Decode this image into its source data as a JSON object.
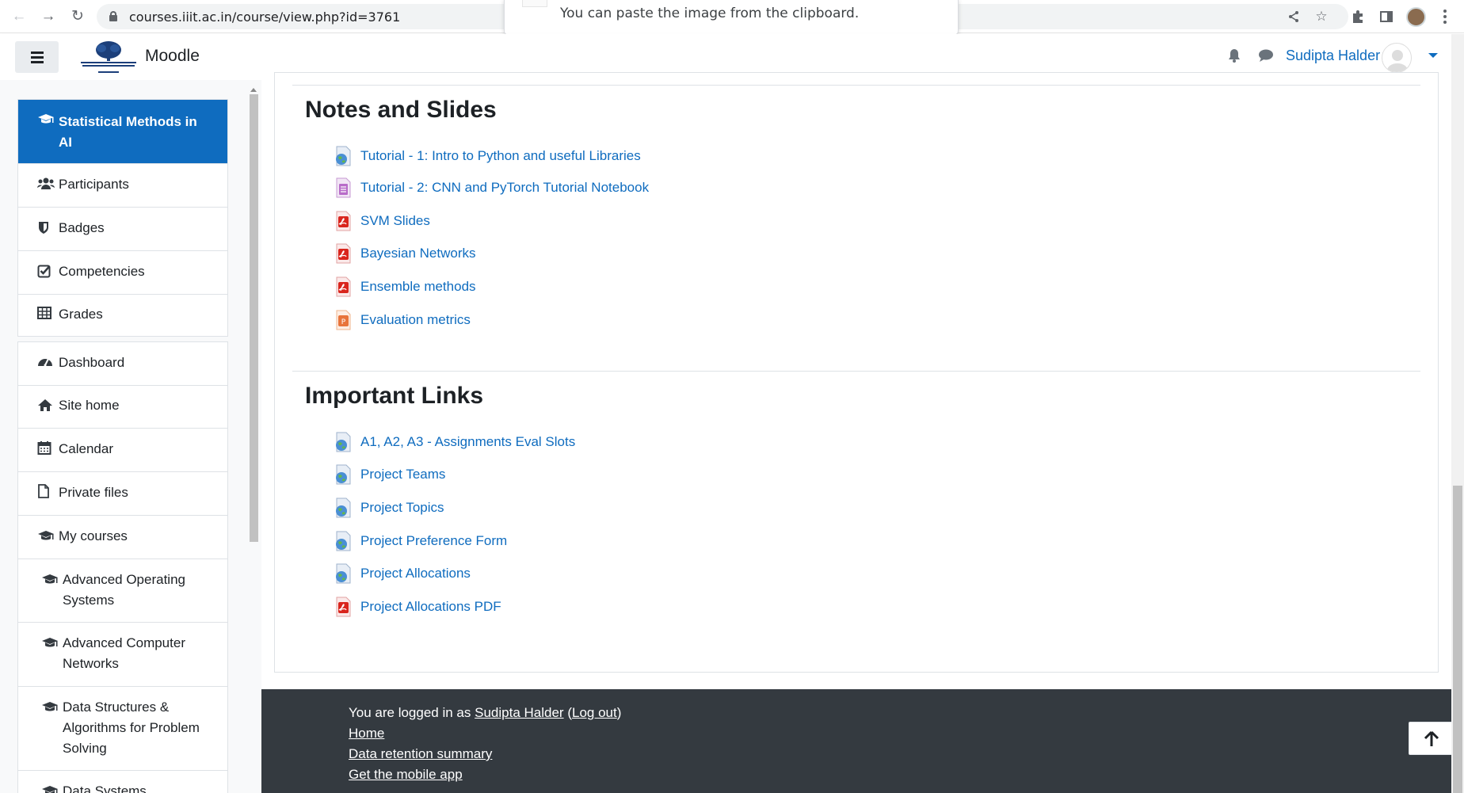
{
  "browser": {
    "url": "courses.iiit.ac.in/course/view.php?id=3761",
    "toast_text": "You can paste the image from the clipboard."
  },
  "navbar": {
    "brand": "Moodle",
    "user_name": "Sudipta Halder"
  },
  "sidebar": {
    "course_items": [
      {
        "label": "Statistical Methods in AI",
        "icon": "graduation-cap-icon",
        "active": true
      },
      {
        "label": "Participants",
        "icon": "users-icon"
      },
      {
        "label": "Badges",
        "icon": "shield-icon"
      },
      {
        "label": "Competencies",
        "icon": "check-square-icon"
      },
      {
        "label": "Grades",
        "icon": "table-icon"
      }
    ],
    "site_items": [
      {
        "label": "Dashboard",
        "icon": "tachometer-icon"
      },
      {
        "label": "Site home",
        "icon": "home-icon"
      },
      {
        "label": "Calendar",
        "icon": "calendar-icon"
      },
      {
        "label": "Private files",
        "icon": "file-icon"
      },
      {
        "label": "My courses",
        "icon": "graduation-cap-icon"
      },
      {
        "label": "Advanced Operating Systems",
        "icon": "graduation-cap-icon"
      },
      {
        "label": "Advanced Computer Networks",
        "icon": "graduation-cap-icon"
      },
      {
        "label": "Data Structures & Algorithms for Problem Solving",
        "icon": "graduation-cap-icon"
      },
      {
        "label": "Data Systems",
        "icon": "graduation-cap-icon"
      }
    ]
  },
  "sections": [
    {
      "title": "Notes and Slides",
      "items": [
        {
          "label": "Tutorial - 1: Intro to Python and useful Libraries",
          "type": "url"
        },
        {
          "label": "Tutorial - 2: CNN and PyTorch Tutorial Notebook",
          "type": "file"
        },
        {
          "label": "SVM Slides",
          "type": "pdf"
        },
        {
          "label": "Bayesian Networks",
          "type": "pdf"
        },
        {
          "label": "Ensemble methods",
          "type": "pdf"
        },
        {
          "label": "Evaluation metrics",
          "type": "pptx"
        }
      ]
    },
    {
      "title": "Important Links",
      "items": [
        {
          "label": "A1, A2, A3 - Assignments Eval Slots",
          "type": "url"
        },
        {
          "label": "Project Teams",
          "type": "url"
        },
        {
          "label": "Project Topics",
          "type": "url"
        },
        {
          "label": "Project Preference Form",
          "type": "url"
        },
        {
          "label": "Project Allocations",
          "type": "url"
        },
        {
          "label": "Project Allocations PDF",
          "type": "pdf"
        }
      ]
    }
  ],
  "footer": {
    "logged_in_prefix": "You are logged in as",
    "user_link": "Sudipta Halder",
    "logout": "Log out",
    "home": "Home",
    "data_retention": "Data retention summary",
    "mobile_app": "Get the mobile app"
  },
  "colors": {
    "link": "#0f6cbf",
    "footer_bg": "#343a40",
    "active_bg": "#0f6cbf"
  }
}
